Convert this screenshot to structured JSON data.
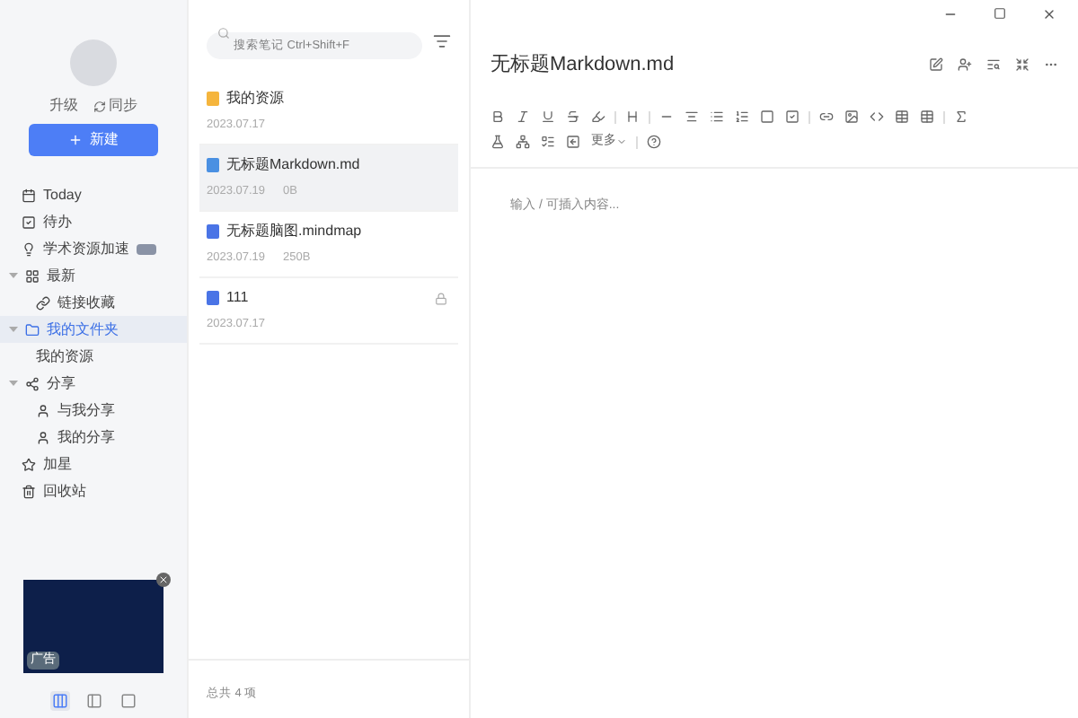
{
  "sidebar": {
    "upgrade": "升级",
    "sync": "同步",
    "new_button": "新建",
    "nav": [
      {
        "label": "Today",
        "selected": false
      },
      {
        "label": "待办",
        "selected": false
      },
      {
        "label": "学术资源加速",
        "badge": true,
        "selected": false
      },
      {
        "label": "最新",
        "expanded": true,
        "selected": false,
        "children": [
          {
            "label": "链接收藏",
            "selected": false
          }
        ]
      },
      {
        "label": "我的文件夹",
        "expanded": true,
        "selected": true,
        "children": [
          {
            "label": "我的资源",
            "selected": false
          }
        ]
      },
      {
        "label": "分享",
        "expanded": true,
        "selected": false,
        "children": [
          {
            "label": "与我分享",
            "selected": false
          },
          {
            "label": "我的分享",
            "selected": false
          }
        ]
      },
      {
        "label": "加星",
        "selected": false
      },
      {
        "label": "回收站",
        "selected": false
      }
    ],
    "ad": {
      "label": "广告"
    },
    "view_modes": [
      {
        "selected": true
      },
      {
        "selected": false
      },
      {
        "selected": false
      }
    ]
  },
  "list": {
    "search": {
      "placeholder": "搜索笔记 Ctrl+Shift+F"
    },
    "items": [
      {
        "kind": "folder",
        "name": "我的资源",
        "date": "2023.07.17",
        "selected": false,
        "locked": false
      },
      {
        "kind": "markdown",
        "name": "无标题Markdown.md",
        "date": "2023.07.19",
        "size": "0B",
        "selected": true,
        "locked": false
      },
      {
        "kind": "mindmap",
        "name": "无标题脑图.mindmap",
        "date": "2023.07.19",
        "size": "250B",
        "selected": false,
        "locked": false
      },
      {
        "kind": "doc",
        "name": "111",
        "date": "2023.07.17",
        "selected": false,
        "locked": true
      }
    ],
    "footer": "总共 4 项"
  },
  "editor": {
    "title": "无标题Markdown.md",
    "more": "更多",
    "placeholder": "输入 / 可插入内容..."
  }
}
